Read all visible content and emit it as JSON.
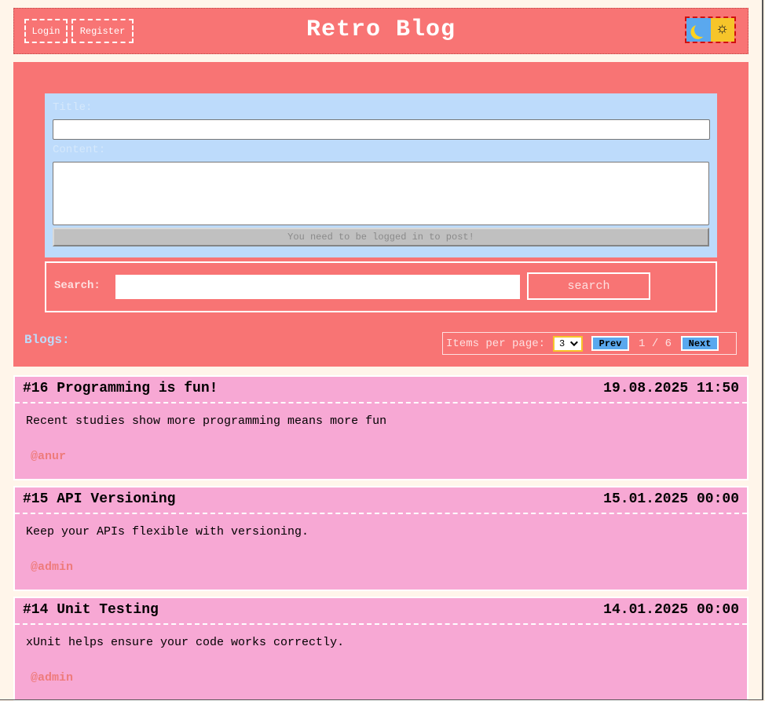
{
  "header": {
    "login_label": "Login",
    "register_label": "Register",
    "title": "Retro Blog",
    "theme_dark_icon": "moon-icon",
    "theme_light_icon": "sun-icon"
  },
  "post_form": {
    "title_label": "Title:",
    "content_label": "Content:",
    "title_value": "",
    "content_value": "",
    "submit_label": "You need to be logged in to post!"
  },
  "search": {
    "label": "Search:",
    "value": "",
    "button_label": "search"
  },
  "blogs": {
    "label": "Blogs:",
    "items_per_page_label": "Items per page:",
    "items_per_page_value": "3",
    "prev_label": "Prev",
    "next_label": "Next",
    "page_info": "1 / 6",
    "posts": [
      {
        "title": "#16 Programming is fun!",
        "date": "19.08.2025 11:50",
        "content": "Recent studies show more programming means more fun",
        "author": "@anur"
      },
      {
        "title": "#15 API Versioning",
        "date": "15.01.2025 00:00",
        "content": "Keep your APIs flexible with versioning.",
        "author": "@admin"
      },
      {
        "title": "#14 Unit Testing",
        "date": "14.01.2025 00:00",
        "content": "xUnit helps ensure your code works correctly.",
        "author": "@admin"
      }
    ]
  },
  "colors": {
    "primary": "#f87474",
    "form_bg": "#bddbfb",
    "card_bg": "#f7a8d4",
    "accent_blue": "#5aa8ee",
    "accent_yellow": "#f6c52a",
    "page_bg": "#fff5ea"
  }
}
